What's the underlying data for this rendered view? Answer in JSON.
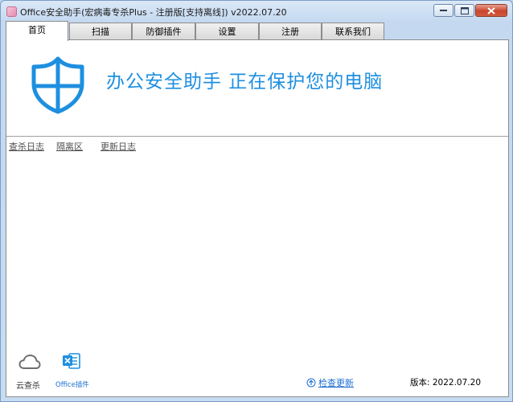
{
  "window": {
    "title": "Office安全助手(宏病毒专杀Plus - 注册版[支持离线]) v2022.07.20"
  },
  "tabs": [
    {
      "label": "首页",
      "active": true
    },
    {
      "label": "扫描"
    },
    {
      "label": "防御插件"
    },
    {
      "label": "设置"
    },
    {
      "label": "注册"
    },
    {
      "label": "联系我们"
    }
  ],
  "home": {
    "headline": "办公安全助手  正在保护您的电脑",
    "links": {
      "scan_log": "查杀日志",
      "quarantine": "隔离区",
      "update_log": "更新日志"
    }
  },
  "bottom": {
    "cloud_scan": "云查杀",
    "office_plugin": "Office插件",
    "check_update": "检查更新",
    "version": "版本: 2022.07.20"
  },
  "colors": {
    "accent": "#1e8fe0",
    "link_blue": "#1e6fd0"
  }
}
